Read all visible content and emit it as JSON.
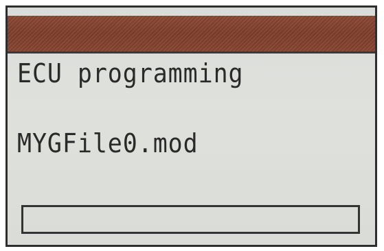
{
  "screen": {
    "title_bar_color": "#7d3c2a",
    "line1": "ECU programming",
    "line2": "MYGFile0.mod",
    "progress": 0
  }
}
